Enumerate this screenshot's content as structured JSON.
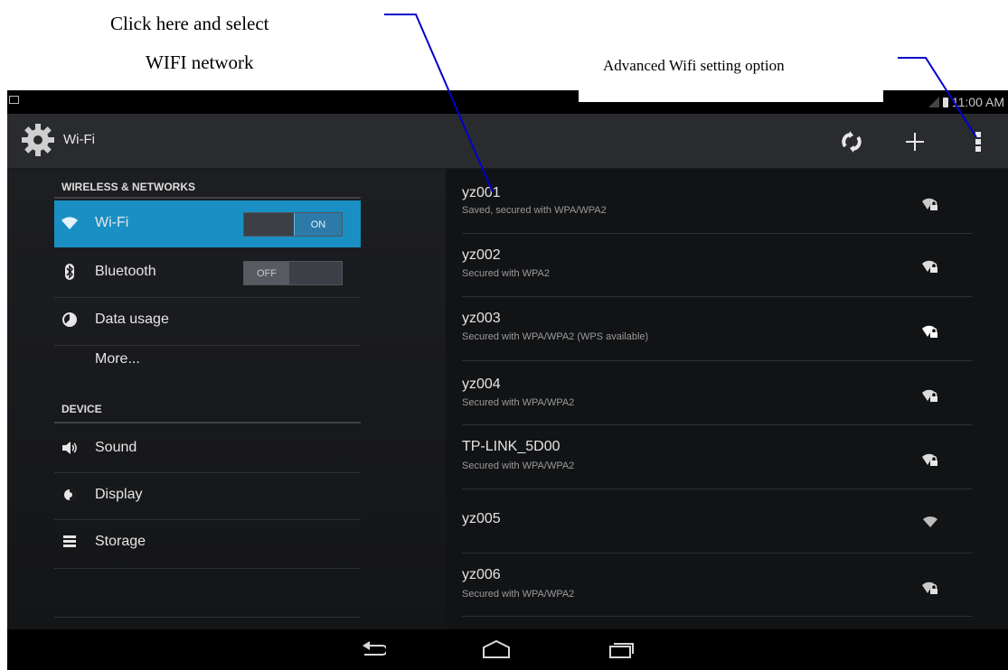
{
  "annotations": {
    "left_line1": "Click here and select",
    "left_line2": "WIFI network",
    "right": "Advanced Wifi setting option",
    "line_color": "#0000cc"
  },
  "status_bar": {
    "time": "11:00 AM"
  },
  "action_bar": {
    "title": "Wi-Fi",
    "icons": [
      "settings-gear-icon",
      "refresh-icon",
      "add-icon",
      "overflow-menu-icon"
    ]
  },
  "sidebar": {
    "sections": [
      {
        "header": "WIRELESS & NETWORKS"
      },
      {
        "header": "DEVICE"
      }
    ],
    "items": [
      {
        "label": "Wi-Fi",
        "icon": "wifi-icon",
        "toggle": "ON",
        "selected": true
      },
      {
        "label": "Bluetooth",
        "icon": "bluetooth-icon",
        "toggle": "OFF"
      },
      {
        "label": "Data usage",
        "icon": "data-usage-icon"
      },
      {
        "label": "More..."
      },
      {
        "label": "Sound",
        "icon": "sound-icon"
      },
      {
        "label": "Display",
        "icon": "display-icon"
      },
      {
        "label": "Storage",
        "icon": "storage-icon"
      }
    ]
  },
  "networks": [
    {
      "ssid": "yz001",
      "status": "Saved, secured with WPA/WPA2",
      "secured": true
    },
    {
      "ssid": "yz002",
      "status": "Secured with WPA2",
      "secured": true
    },
    {
      "ssid": "yz003",
      "status": "Secured with WPA/WPA2 (WPS available)",
      "secured": true
    },
    {
      "ssid": "yz004",
      "status": "Secured with WPA/WPA2",
      "secured": true
    },
    {
      "ssid": "TP-LINK_5D00",
      "status": "Secured with WPA/WPA2",
      "secured": true
    },
    {
      "ssid": "yz005",
      "status": "",
      "secured": false
    },
    {
      "ssid": "yz006",
      "status": "Secured with WPA/WPA2",
      "secured": true
    }
  ],
  "colors": {
    "accent": "#1a8fc4",
    "background": "#121315",
    "action_bar": "#2a2b2e"
  }
}
